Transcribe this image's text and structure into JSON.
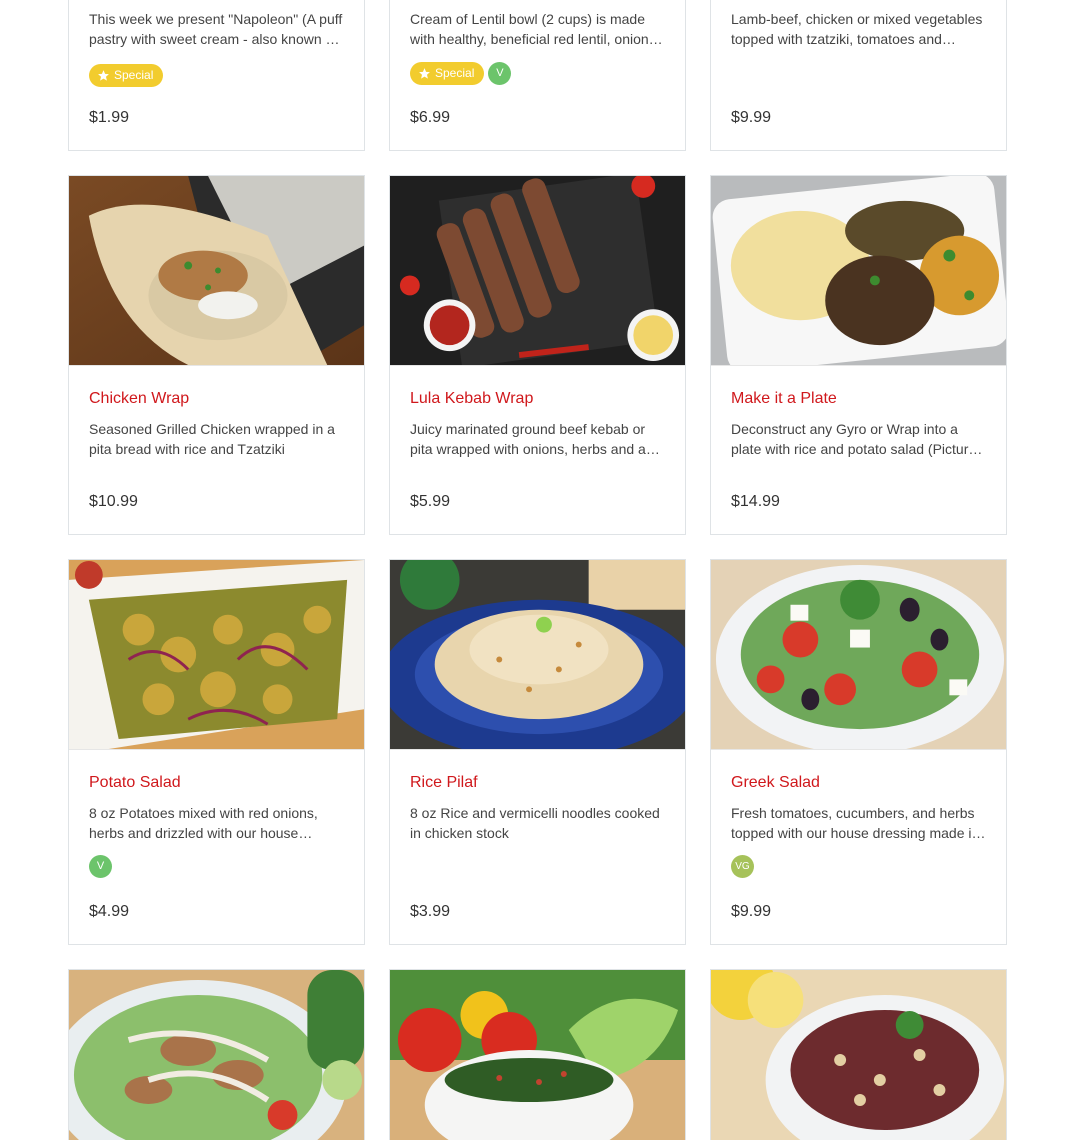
{
  "menu_items": [
    {
      "description": "This week we present \"Napoleon\" (A puff pastry with sweet cream - also known as mille-feuille)",
      "badges": {
        "special": "Special"
      },
      "price": "$1.99"
    },
    {
      "description": "Cream of Lentil bowl (2 cups) is made with healthy, beneficial red lentil, onions and carrots",
      "badges": {
        "special": "Special",
        "diet": "V"
      },
      "price": "$6.99"
    },
    {
      "description": "Lamb-beef, chicken or mixed vegetables topped with tzatziki, tomatoes and onions",
      "price": "$9.99"
    },
    {
      "title": "Chicken Wrap",
      "description": "Seasoned Grilled Chicken wrapped in a pita bread with rice and Tzatziki",
      "price": "$10.99"
    },
    {
      "title": "Lula Kebab Wrap",
      "description": "Juicy marinated ground beef kebab or pita wrapped with onions, herbs and a sauce",
      "price": "$5.99"
    },
    {
      "title": "Make it a Plate",
      "description": "Deconstruct any Gyro or Wrap into a plate with rice and potato salad (Picture shown)",
      "price": "$14.99"
    },
    {
      "title": "Potato Salad",
      "description": "8 oz Potatoes mixed with red onions, herbs and drizzled with our house dressing",
      "badges": {
        "diet": "V"
      },
      "price": "$4.99"
    },
    {
      "title": "Rice Pilaf",
      "description": "8 oz Rice and vermicelli noodles cooked in chicken stock",
      "price": "$3.99"
    },
    {
      "title": "Greek Salad",
      "description": "Fresh tomatoes, cucumbers, and herbs topped with our house dressing made in house",
      "badges": {
        "diet": "VG"
      },
      "price": "$9.99"
    }
  ],
  "colors": {
    "title_red": "#d0181c",
    "special_badge": "#f2cc2e",
    "vegetarian_badge": "#6cc46b",
    "vegan_badge": "#a6c25a"
  }
}
